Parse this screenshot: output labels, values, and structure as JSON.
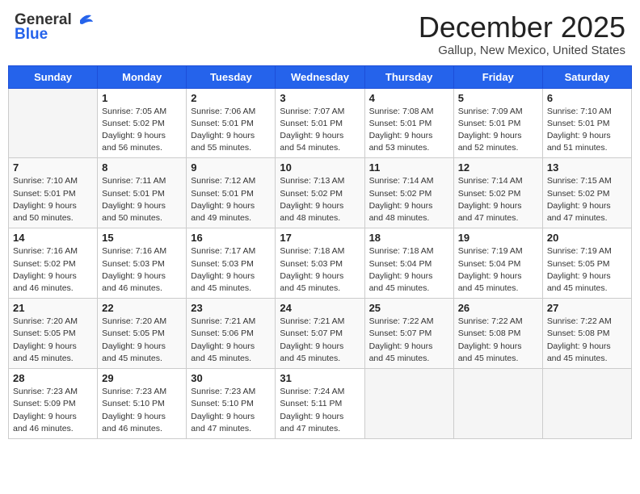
{
  "header": {
    "logo_general": "General",
    "logo_blue": "Blue",
    "month_title": "December 2025",
    "location": "Gallup, New Mexico, United States"
  },
  "weekdays": [
    "Sunday",
    "Monday",
    "Tuesday",
    "Wednesday",
    "Thursday",
    "Friday",
    "Saturday"
  ],
  "weeks": [
    [
      {
        "day": "",
        "sunrise": "",
        "sunset": "",
        "daylight": ""
      },
      {
        "day": "1",
        "sunrise": "Sunrise: 7:05 AM",
        "sunset": "Sunset: 5:02 PM",
        "daylight": "Daylight: 9 hours and 56 minutes."
      },
      {
        "day": "2",
        "sunrise": "Sunrise: 7:06 AM",
        "sunset": "Sunset: 5:01 PM",
        "daylight": "Daylight: 9 hours and 55 minutes."
      },
      {
        "day": "3",
        "sunrise": "Sunrise: 7:07 AM",
        "sunset": "Sunset: 5:01 PM",
        "daylight": "Daylight: 9 hours and 54 minutes."
      },
      {
        "day": "4",
        "sunrise": "Sunrise: 7:08 AM",
        "sunset": "Sunset: 5:01 PM",
        "daylight": "Daylight: 9 hours and 53 minutes."
      },
      {
        "day": "5",
        "sunrise": "Sunrise: 7:09 AM",
        "sunset": "Sunset: 5:01 PM",
        "daylight": "Daylight: 9 hours and 52 minutes."
      },
      {
        "day": "6",
        "sunrise": "Sunrise: 7:10 AM",
        "sunset": "Sunset: 5:01 PM",
        "daylight": "Daylight: 9 hours and 51 minutes."
      }
    ],
    [
      {
        "day": "7",
        "sunrise": "Sunrise: 7:10 AM",
        "sunset": "Sunset: 5:01 PM",
        "daylight": "Daylight: 9 hours and 50 minutes."
      },
      {
        "day": "8",
        "sunrise": "Sunrise: 7:11 AM",
        "sunset": "Sunset: 5:01 PM",
        "daylight": "Daylight: 9 hours and 50 minutes."
      },
      {
        "day": "9",
        "sunrise": "Sunrise: 7:12 AM",
        "sunset": "Sunset: 5:01 PM",
        "daylight": "Daylight: 9 hours and 49 minutes."
      },
      {
        "day": "10",
        "sunrise": "Sunrise: 7:13 AM",
        "sunset": "Sunset: 5:02 PM",
        "daylight": "Daylight: 9 hours and 48 minutes."
      },
      {
        "day": "11",
        "sunrise": "Sunrise: 7:14 AM",
        "sunset": "Sunset: 5:02 PM",
        "daylight": "Daylight: 9 hours and 48 minutes."
      },
      {
        "day": "12",
        "sunrise": "Sunrise: 7:14 AM",
        "sunset": "Sunset: 5:02 PM",
        "daylight": "Daylight: 9 hours and 47 minutes."
      },
      {
        "day": "13",
        "sunrise": "Sunrise: 7:15 AM",
        "sunset": "Sunset: 5:02 PM",
        "daylight": "Daylight: 9 hours and 47 minutes."
      }
    ],
    [
      {
        "day": "14",
        "sunrise": "Sunrise: 7:16 AM",
        "sunset": "Sunset: 5:02 PM",
        "daylight": "Daylight: 9 hours and 46 minutes."
      },
      {
        "day": "15",
        "sunrise": "Sunrise: 7:16 AM",
        "sunset": "Sunset: 5:03 PM",
        "daylight": "Daylight: 9 hours and 46 minutes."
      },
      {
        "day": "16",
        "sunrise": "Sunrise: 7:17 AM",
        "sunset": "Sunset: 5:03 PM",
        "daylight": "Daylight: 9 hours and 45 minutes."
      },
      {
        "day": "17",
        "sunrise": "Sunrise: 7:18 AM",
        "sunset": "Sunset: 5:03 PM",
        "daylight": "Daylight: 9 hours and 45 minutes."
      },
      {
        "day": "18",
        "sunrise": "Sunrise: 7:18 AM",
        "sunset": "Sunset: 5:04 PM",
        "daylight": "Daylight: 9 hours and 45 minutes."
      },
      {
        "day": "19",
        "sunrise": "Sunrise: 7:19 AM",
        "sunset": "Sunset: 5:04 PM",
        "daylight": "Daylight: 9 hours and 45 minutes."
      },
      {
        "day": "20",
        "sunrise": "Sunrise: 7:19 AM",
        "sunset": "Sunset: 5:05 PM",
        "daylight": "Daylight: 9 hours and 45 minutes."
      }
    ],
    [
      {
        "day": "21",
        "sunrise": "Sunrise: 7:20 AM",
        "sunset": "Sunset: 5:05 PM",
        "daylight": "Daylight: 9 hours and 45 minutes."
      },
      {
        "day": "22",
        "sunrise": "Sunrise: 7:20 AM",
        "sunset": "Sunset: 5:05 PM",
        "daylight": "Daylight: 9 hours and 45 minutes."
      },
      {
        "day": "23",
        "sunrise": "Sunrise: 7:21 AM",
        "sunset": "Sunset: 5:06 PM",
        "daylight": "Daylight: 9 hours and 45 minutes."
      },
      {
        "day": "24",
        "sunrise": "Sunrise: 7:21 AM",
        "sunset": "Sunset: 5:07 PM",
        "daylight": "Daylight: 9 hours and 45 minutes."
      },
      {
        "day": "25",
        "sunrise": "Sunrise: 7:22 AM",
        "sunset": "Sunset: 5:07 PM",
        "daylight": "Daylight: 9 hours and 45 minutes."
      },
      {
        "day": "26",
        "sunrise": "Sunrise: 7:22 AM",
        "sunset": "Sunset: 5:08 PM",
        "daylight": "Daylight: 9 hours and 45 minutes."
      },
      {
        "day": "27",
        "sunrise": "Sunrise: 7:22 AM",
        "sunset": "Sunset: 5:08 PM",
        "daylight": "Daylight: 9 hours and 45 minutes."
      }
    ],
    [
      {
        "day": "28",
        "sunrise": "Sunrise: 7:23 AM",
        "sunset": "Sunset: 5:09 PM",
        "daylight": "Daylight: 9 hours and 46 minutes."
      },
      {
        "day": "29",
        "sunrise": "Sunrise: 7:23 AM",
        "sunset": "Sunset: 5:10 PM",
        "daylight": "Daylight: 9 hours and 46 minutes."
      },
      {
        "day": "30",
        "sunrise": "Sunrise: 7:23 AM",
        "sunset": "Sunset: 5:10 PM",
        "daylight": "Daylight: 9 hours and 47 minutes."
      },
      {
        "day": "31",
        "sunrise": "Sunrise: 7:24 AM",
        "sunset": "Sunset: 5:11 PM",
        "daylight": "Daylight: 9 hours and 47 minutes."
      },
      {
        "day": "",
        "sunrise": "",
        "sunset": "",
        "daylight": ""
      },
      {
        "day": "",
        "sunrise": "",
        "sunset": "",
        "daylight": ""
      },
      {
        "day": "",
        "sunrise": "",
        "sunset": "",
        "daylight": ""
      }
    ]
  ]
}
